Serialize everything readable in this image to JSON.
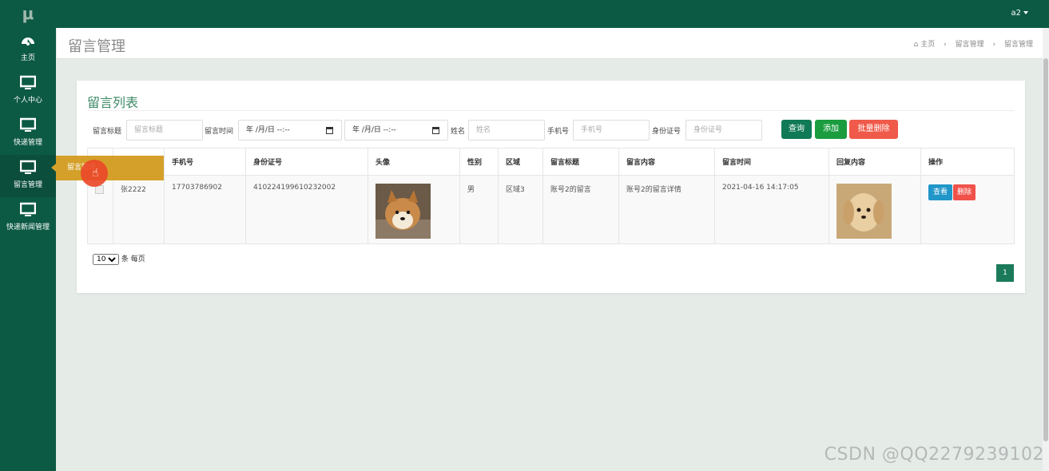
{
  "app": {
    "logo": "μ",
    "user": "a2"
  },
  "sidebar": {
    "items": [
      {
        "label": "主页",
        "icon": "dashboard-icon"
      },
      {
        "label": "个人中心",
        "icon": "monitor-icon"
      },
      {
        "label": "快递管理",
        "icon": "monitor-icon"
      },
      {
        "label": "留言管理",
        "icon": "monitor-icon"
      },
      {
        "label": "快递新闻管理",
        "icon": "monitor-icon"
      }
    ],
    "flyout_label": "留言管理"
  },
  "header": {
    "title": "留言管理",
    "breadcrumb": [
      "主页",
      "留言管理",
      "留言管理"
    ]
  },
  "card": {
    "title": "留言列表",
    "filters": {
      "title_label": "留言标题",
      "title_placeholder": "留言标题",
      "time_label": "留言时间",
      "date_start": "年 /月/日 --:--",
      "date_end": "年 /月/日 --:--",
      "name_label": "姓名",
      "name_placeholder": "姓名",
      "phone_label": "手机号",
      "phone_placeholder": "手机号",
      "id_label": "身份证号",
      "id_placeholder": "身份证号"
    },
    "buttons": {
      "query": "查询",
      "add": "添加",
      "batch_delete": "批量删除"
    },
    "table": {
      "headers": [
        "",
        "",
        "手机号",
        "身份证号",
        "头像",
        "性别",
        "区域",
        "留言标题",
        "留言内容",
        "留言时间",
        "回复内容",
        "操作"
      ],
      "rows": [
        {
          "name": "张2222",
          "phone": "17703786902",
          "id_number": "410224199610232002",
          "gender": "男",
          "region": "区域3",
          "msg_title": "账号2的留言",
          "msg_content": "账号2的留言详情",
          "msg_time": "2021-04-16 14:17:05",
          "view_label": "查看",
          "delete_label": "删除"
        }
      ]
    },
    "page_size": "10",
    "page_size_suffix": "条 每页",
    "current_page": "1"
  },
  "watermark": "CSDN @QQ2279239102",
  "colors": {
    "sidebar": "#0d5a44",
    "accent": "#3c8a66",
    "flyout": "#d4a02a"
  }
}
